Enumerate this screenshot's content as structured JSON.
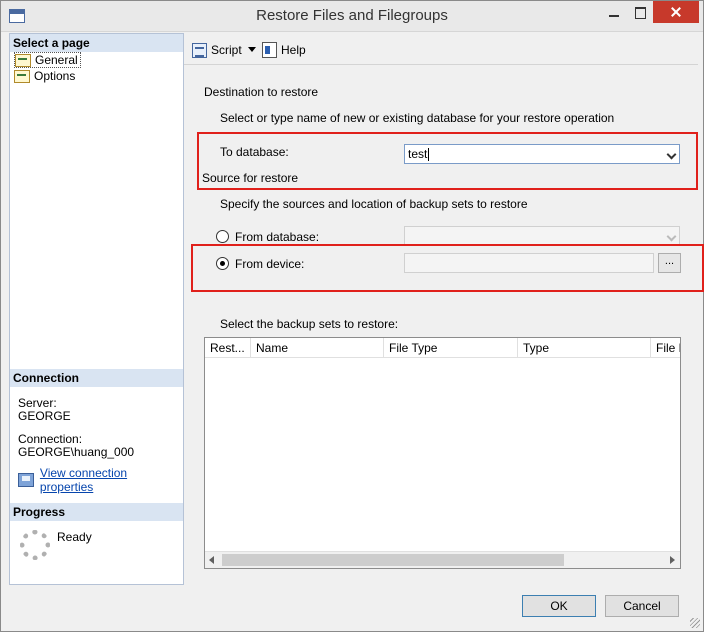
{
  "window": {
    "title": "Restore Files and Filegroups"
  },
  "leftpane": {
    "select_page_header": "Select a page",
    "pages": [
      {
        "label": "General",
        "icon": "page-icon",
        "selected": true
      },
      {
        "label": "Options",
        "icon": "page-icon",
        "selected": false
      }
    ],
    "connection_header": "Connection",
    "server_label": "Server:",
    "server_value": "GEORGE",
    "connection_label": "Connection:",
    "connection_value": "GEORGE\\huang_000",
    "view_connection_link": "View connection properties",
    "progress_header": "Progress",
    "progress_status": "Ready"
  },
  "toolbar": {
    "script_label": "Script",
    "help_label": "Help"
  },
  "destination": {
    "heading": "Destination to restore",
    "instruction": "Select or type name of new or existing database for your restore operation",
    "to_database_label": "To database:",
    "to_database_value": "test"
  },
  "source": {
    "heading": "Source for restore",
    "instruction": "Specify the sources and location of backup sets to restore",
    "from_database_label": "From database:",
    "from_device_label": "From device:",
    "from_device_value": "",
    "browse_label": "...",
    "selected": "from_device"
  },
  "backup_sets": {
    "label": "Select the backup sets to restore:",
    "columns": [
      "Rest...",
      "Name",
      "File Type",
      "Type",
      "File L"
    ]
  },
  "buttons": {
    "ok": "OK",
    "cancel": "Cancel"
  },
  "colors": {
    "highlight_box": "#e0201b",
    "link": "#0645ad",
    "section_header": "#d9e4f2"
  }
}
